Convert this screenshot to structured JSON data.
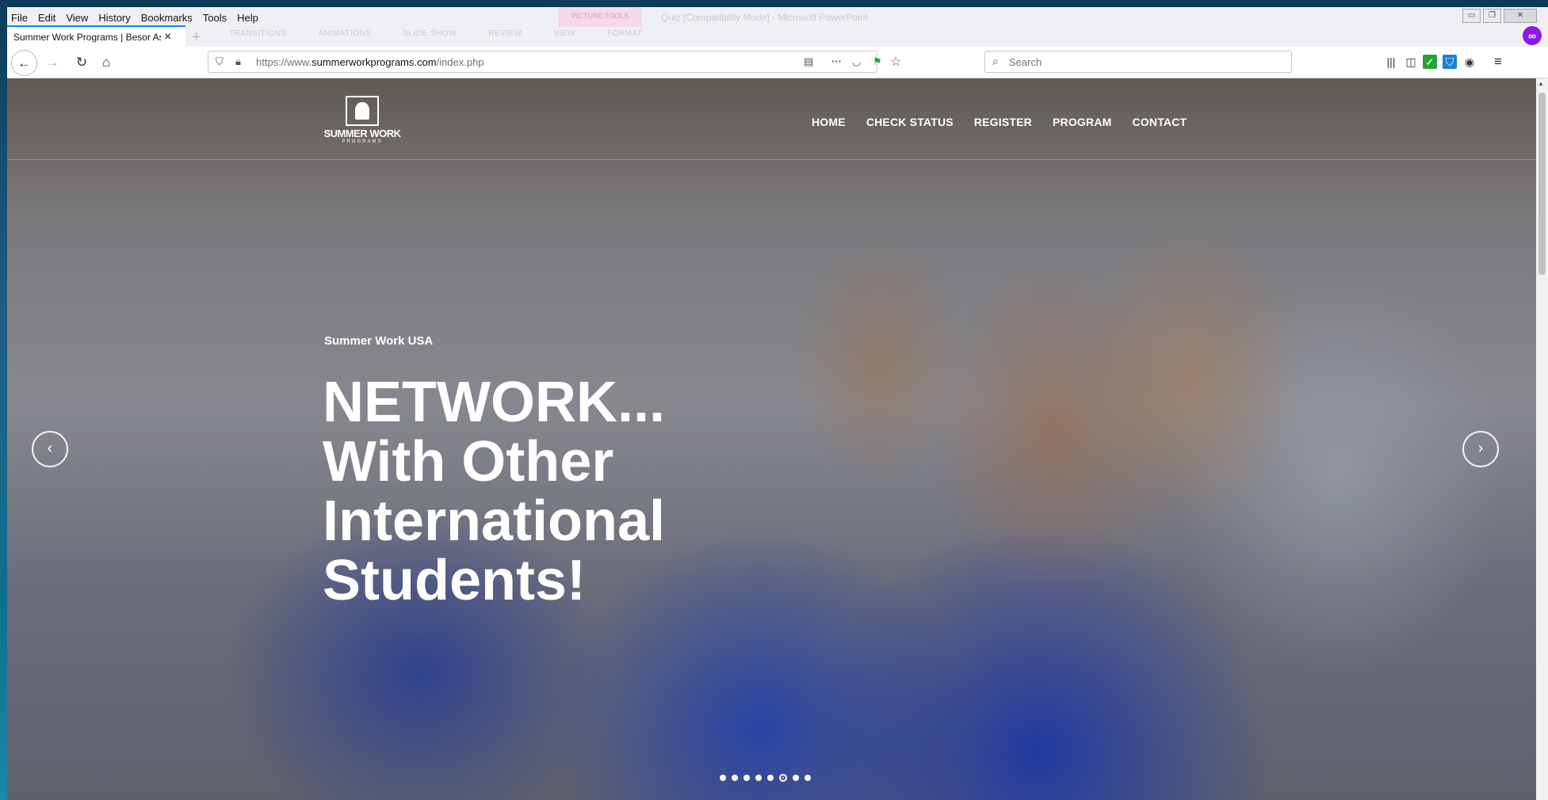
{
  "menu": [
    "File",
    "Edit",
    "View",
    "History",
    "Bookmarks",
    "Tools",
    "Help"
  ],
  "tab": {
    "title": "Summer Work Programs | Besor As",
    "close": "×"
  },
  "background_window": {
    "title": "Quiz [Compatibility Mode] - Microsoft PowerPoint",
    "context_tab": "PICTURE TOOLS",
    "ribbon_tabs": [
      "TRANSITIONS",
      "ANIMATIONS",
      "SLIDE SHOW",
      "REVIEW",
      "VIEW",
      "FORMAT"
    ]
  },
  "address": {
    "prefix": "https://www.",
    "domain": "summerworkprograms.com",
    "path": "/index.php"
  },
  "search": {
    "placeholder": "Search"
  },
  "site": {
    "logo_name": "SUMMER WORK",
    "logo_sub": "PROGRAMS",
    "nav": [
      "HOME",
      "CHECK STATUS",
      "REGISTER",
      "PROGRAM",
      "CONTACT"
    ]
  },
  "hero": {
    "kicker": "Summer Work USA",
    "headline": [
      "NETWORK...",
      "With Other",
      "International",
      "Students!"
    ],
    "prev": "‹",
    "next": "›",
    "slide_count": 8,
    "active_slide": 6
  }
}
